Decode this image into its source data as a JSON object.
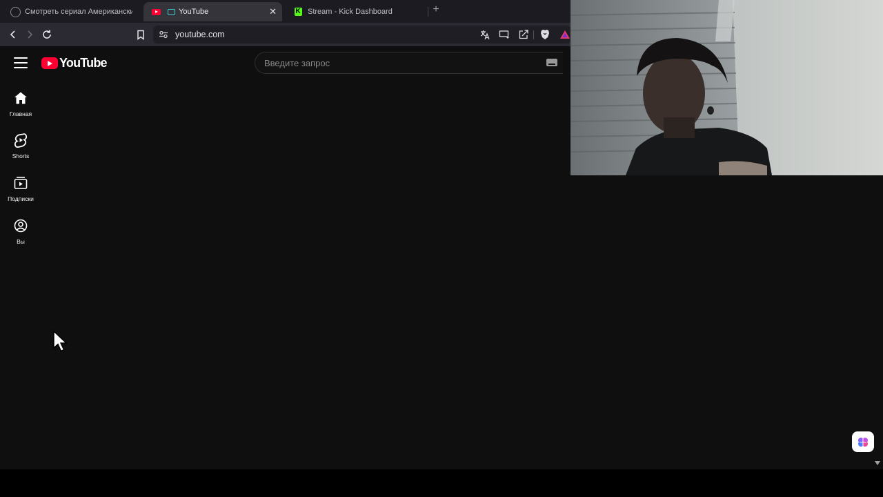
{
  "browser": {
    "tabs": [
      {
        "label": "Смотреть сериал Американский па",
        "icon": "globe-icon",
        "active": false
      },
      {
        "label": "YouTube",
        "icon": "youtube-icon",
        "active": true
      },
      {
        "label": "Stream - Kick Dashboard",
        "icon": "kick-icon",
        "active": false
      }
    ],
    "kick_icon_letter": "K",
    "close_tab_glyph": "✕",
    "new_tab_glyph": "+",
    "url": "youtube.com"
  },
  "youtube": {
    "logo_text": "YouTube",
    "search_placeholder": "Введите запрос",
    "sidebar": [
      {
        "label": "Главная",
        "icon": "home-icon"
      },
      {
        "label": "Shorts",
        "icon": "shorts-icon"
      },
      {
        "label": "Подписки",
        "icon": "subscriptions-icon"
      },
      {
        "label": "Вы",
        "icon": "you-icon"
      }
    ],
    "colors": {
      "brand_red": "#ff0033",
      "background": "#0f0f0f"
    }
  }
}
